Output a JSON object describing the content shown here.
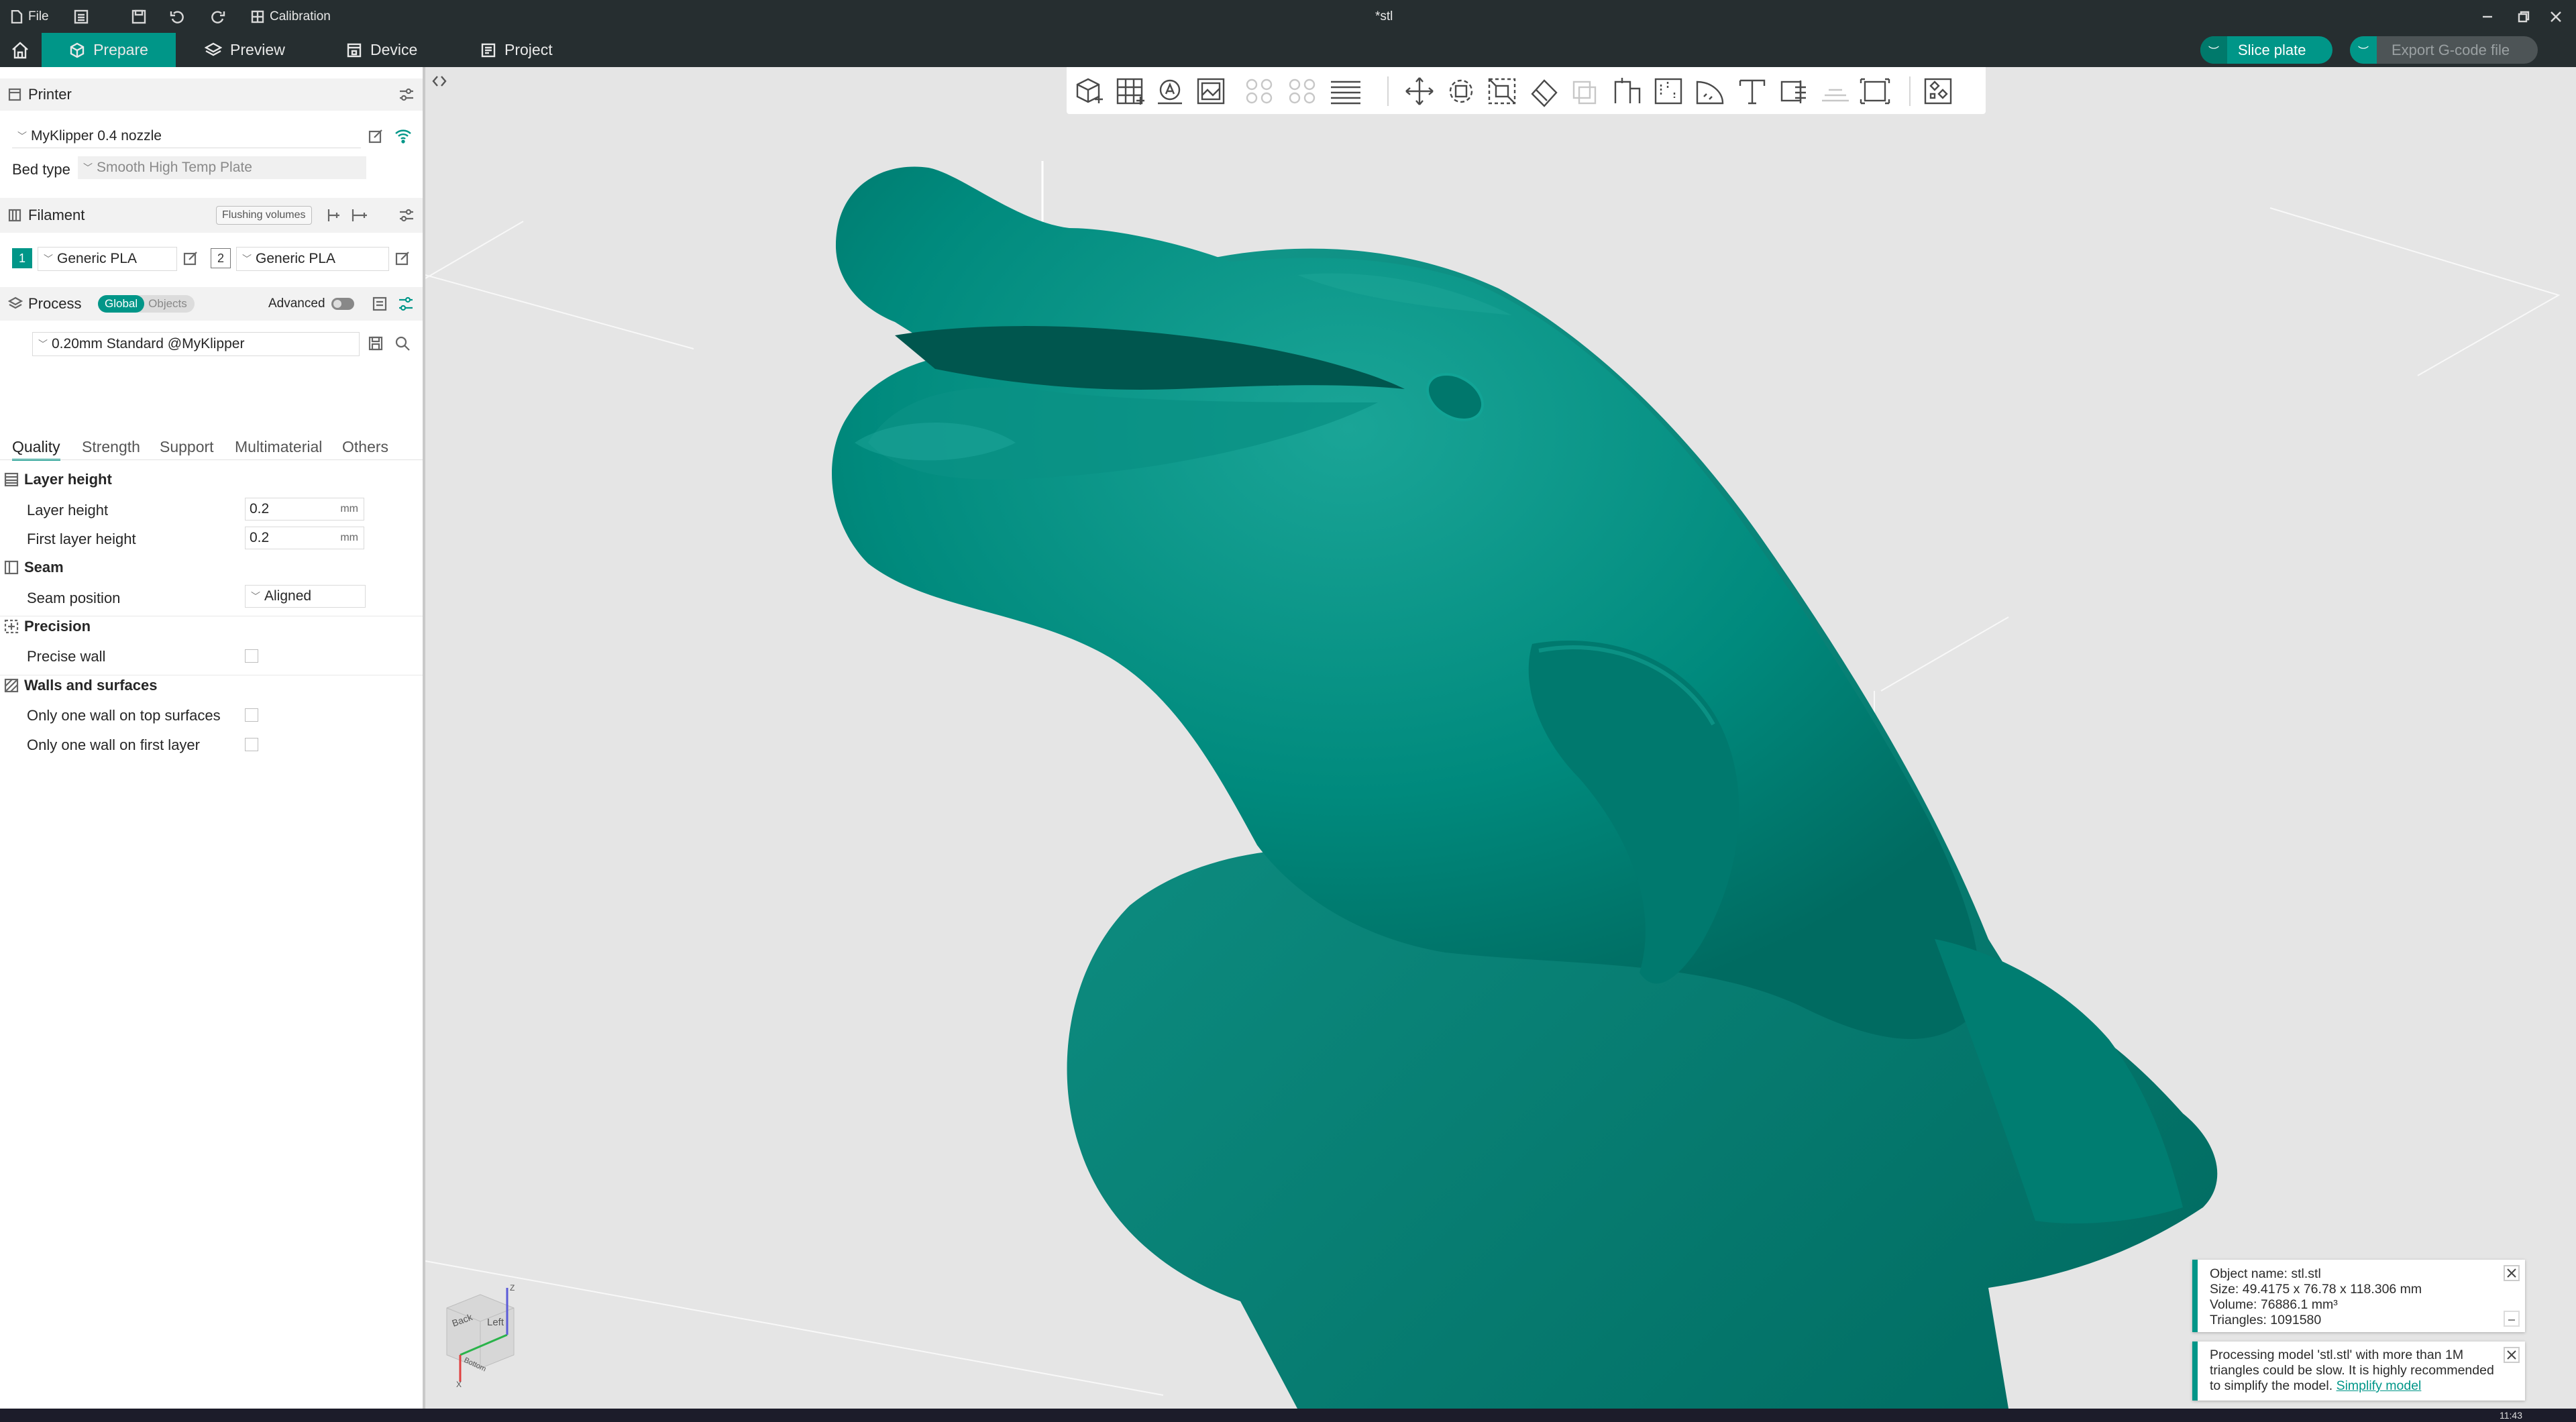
{
  "titlebar": {
    "file_label": "File",
    "calibration_label": "Calibration",
    "window_title": "*stl"
  },
  "tabs": [
    {
      "label": "Prepare",
      "active": true
    },
    {
      "label": "Preview",
      "active": false
    },
    {
      "label": "Device",
      "active": false
    },
    {
      "label": "Project",
      "active": false
    }
  ],
  "actions": {
    "slice_label": "Slice plate",
    "export_label": "Export G-code file"
  },
  "printer": {
    "section_label": "Printer",
    "preset": "MyKlipper 0.4 nozzle",
    "bed_type_label": "Bed type",
    "bed_type_value": "Smooth High Temp Plate"
  },
  "filament": {
    "section_label": "Filament",
    "flushing_label": "Flushing volumes",
    "slots": [
      {
        "index": "1",
        "name": "Generic PLA",
        "color": "#009688"
      },
      {
        "index": "2",
        "name": "Generic PLA",
        "color": "#ffffff"
      }
    ]
  },
  "process": {
    "section_label": "Process",
    "global_label": "Global",
    "objects_label": "Objects",
    "advanced_label": "Advanced",
    "preset": "0.20mm Standard @MyKlipper",
    "subtabs": [
      "Quality",
      "Strength",
      "Support",
      "Multimaterial",
      "Others"
    ],
    "layer_height_group": "Layer height",
    "layer_height_label": "Layer height",
    "layer_height_value": "0.2",
    "first_layer_height_label": "First layer height",
    "first_layer_height_value": "0.2",
    "unit_mm": "mm",
    "seam_group": "Seam",
    "seam_position_label": "Seam position",
    "seam_position_value": "Aligned",
    "precision_group": "Precision",
    "precise_wall_label": "Precise wall",
    "walls_group": "Walls and surfaces",
    "one_wall_top_label": "Only one wall on top surfaces",
    "one_wall_first_label": "Only one wall on first layer"
  },
  "view_cube": {
    "back": "Back",
    "left": "Left",
    "bottom": "Bottom",
    "z": "Z",
    "x": "X"
  },
  "object_info": {
    "name": "Object name: stl.stl",
    "size": "Size: 49.4175 x 76.78 x 118.306 mm",
    "volume": "Volume: 76886.1 mm³",
    "triangles": "Triangles: 1091580"
  },
  "warning": {
    "text": "Processing model 'stl.stl' with more than 1M triangles could be slow. It is highly recommended to simplify the model.",
    "link": "Simplify model"
  },
  "taskbar": {
    "clock": "11:43"
  },
  "colors": {
    "accent": "#009688",
    "model": "#00847a",
    "titlebar": "#262e30"
  }
}
